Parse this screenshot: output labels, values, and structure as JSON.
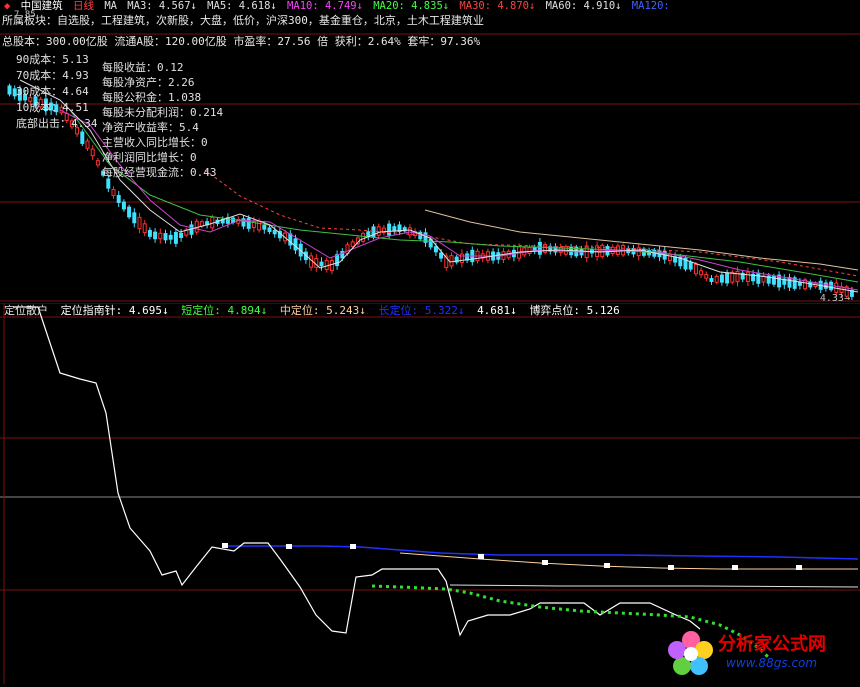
{
  "header": {
    "stock_name": "中国建筑",
    "period": "日线",
    "ma_label": "MA",
    "ma_items": [
      {
        "text": "MA3: 4.567↓",
        "color": "#e0e0e0"
      },
      {
        "text": "MA5: 4.618↓",
        "color": "#e0e0e0"
      },
      {
        "text": "MA10: 4.749↓",
        "color": "#ff40ff"
      },
      {
        "text": "MA20: 4.835↓",
        "color": "#40ff40"
      },
      {
        "text": "MA30: 4.870↓",
        "color": "#ff4040"
      },
      {
        "text": "MA60: 4.910↓",
        "color": "#e0e0e0"
      },
      {
        "text": "MA120:",
        "color": "#4060ff"
      }
    ]
  },
  "sector_line": "所属板块：自选股，工程建筑，次新股，大盘，低价，沪深300，基金重仓，北京，土木工程建筑业",
  "capital_line": "总股本：300.00亿股   流通A股：120.00亿股   市盈率：27.56 倍  获利：2.64%  套牢：97.36%",
  "top_price_label": "7.85",
  "cost_list": [
    "90成本：5.13",
    "70成本：4.93",
    "30成本：4.64",
    "10成本：4.51",
    "底部出击：4.34"
  ],
  "financials": [
    "每股收益：0.12",
    "每股净资产：2.26",
    "每股公积金：1.038",
    "每股未分配利润：0.214",
    "净资产收益率：5.4",
    "主营收入同比增长：0",
    "净利润同比增长：0",
    "每股经营现金流：0.43"
  ],
  "last_price_label": "4.33",
  "indicator": {
    "name": "定位散户",
    "items": [
      {
        "text": "定位指南针: 4.695↓",
        "color": "#ffffff"
      },
      {
        "text": "短定位: 4.894↓",
        "color": "#40ff40"
      },
      {
        "text": "中定位: 5.243↓",
        "color": "#ffd0a0"
      },
      {
        "text": "长定位: 5.322↓",
        "color": "#2030ff"
      },
      {
        "text": "4.681↓",
        "color": "#ffffff"
      },
      {
        "text": "博弈点位: 5.126",
        "color": "#ffffff"
      }
    ]
  },
  "watermark": {
    "name": "分析家公式网",
    "url": "www.88gs.com"
  }
}
